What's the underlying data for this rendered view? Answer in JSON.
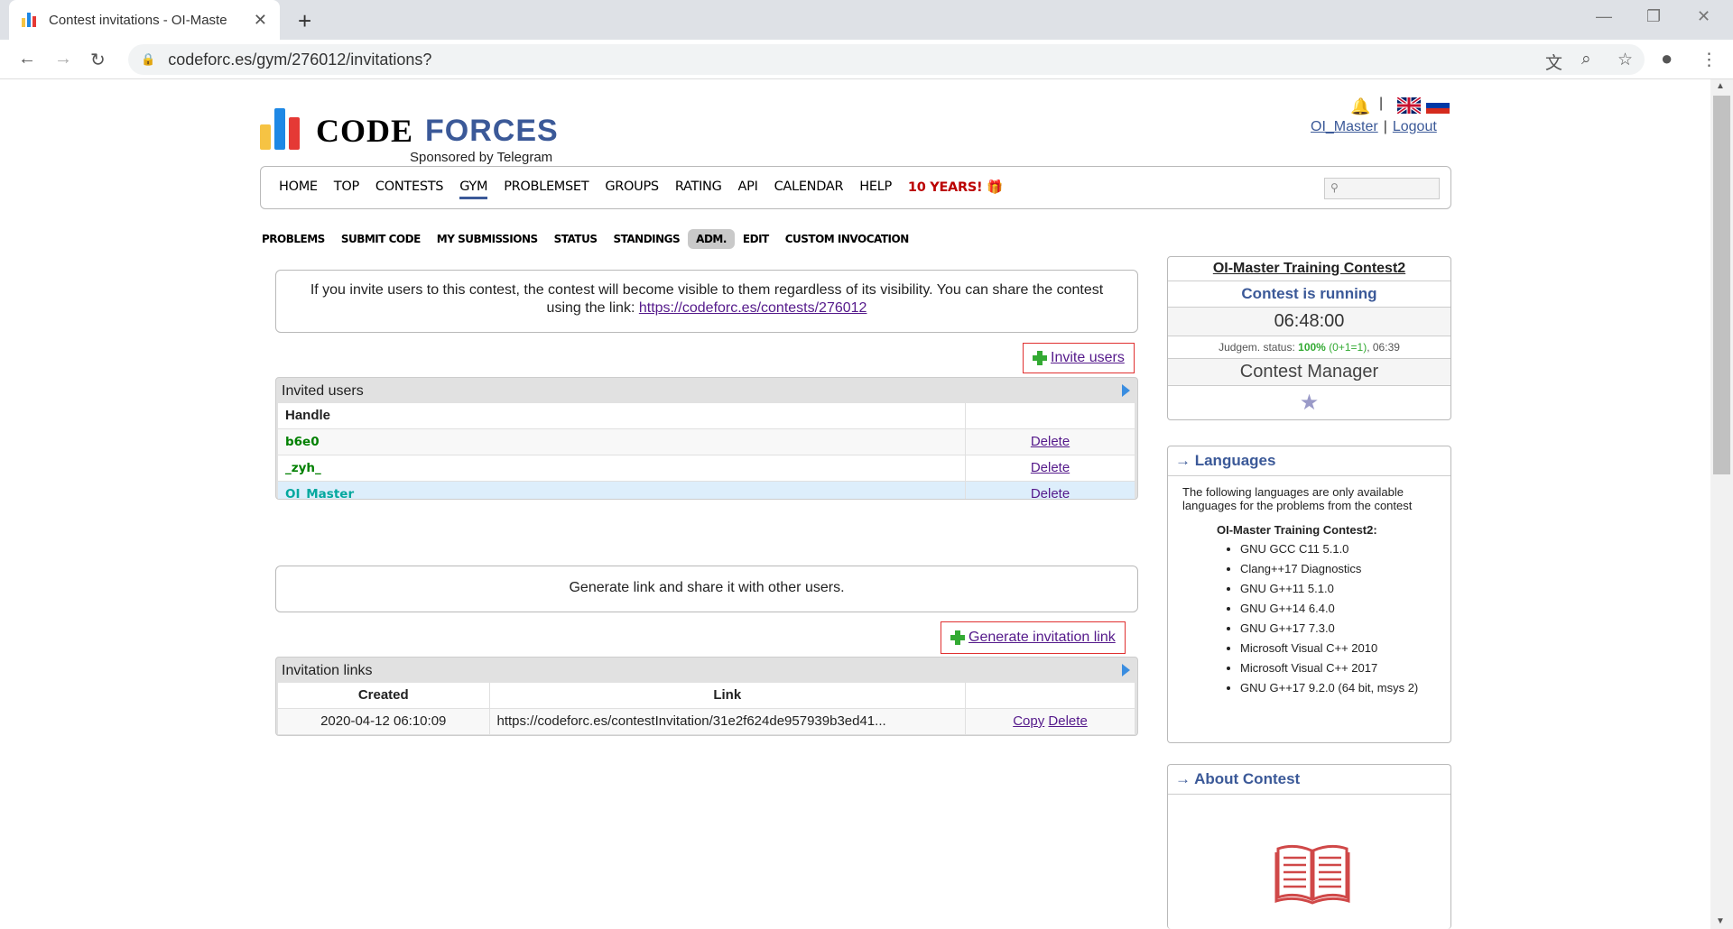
{
  "browser": {
    "tab_title": "Contest invitations - OI-Maste",
    "url": "codeforc.es/gym/276012/invitations?"
  },
  "header": {
    "logo_word1": "CODE",
    "logo_word2": "FORCES",
    "sponsor": "Sponsored by Telegram",
    "user": "OI_Master",
    "logout": "Logout",
    "separator": "|"
  },
  "menu": {
    "items": [
      "HOME",
      "TOP",
      "CONTESTS",
      "GYM",
      "PROBLEMSET",
      "GROUPS",
      "RATING",
      "API",
      "CALENDAR",
      "HELP"
    ],
    "ten_years": "10 YEARS!",
    "active": "GYM"
  },
  "submenu": {
    "items": [
      "PROBLEMS",
      "SUBMIT CODE",
      "MY SUBMISSIONS",
      "STATUS",
      "STANDINGS",
      "ADM.",
      "EDIT",
      "CUSTOM INVOCATION"
    ],
    "selected": "ADM."
  },
  "invite_notice": {
    "text": "If you invite users to this contest, the contest will become visible to them regardless of its visibility. You can share the contest using the link:",
    "link": "https://codeforc.es/contests/276012"
  },
  "invite_button": "Invite users",
  "invited_users": {
    "caption": "Invited users",
    "header": "Handle",
    "rows": [
      {
        "handle": "b6e0",
        "action": "Delete"
      },
      {
        "handle": "_zyh_",
        "action": "Delete"
      },
      {
        "handle": "OI_Master",
        "action": "Delete"
      }
    ]
  },
  "generate_notice": "Generate link and share it with other users.",
  "generate_button": "Generate invitation link",
  "invitation_links": {
    "caption": "Invitation links",
    "headers": [
      "Created",
      "Link"
    ],
    "rows": [
      {
        "created": "2020-04-12 06:10:09",
        "link": "https://codeforc.es/contestInvitation/31e2f624de957939b3ed41...",
        "copy": "Copy",
        "delete": "Delete"
      }
    ]
  },
  "sidebar": {
    "contest_name": "OI-Master Training Contest2",
    "status": "Contest is running",
    "time": "06:48:00",
    "judge_label": "Judgem. status:",
    "judge_pct": "100%",
    "judge_detail": "(0+1=1)",
    "judge_time": ", 06:39",
    "manager": "Contest Manager",
    "languages_title": "→ Languages",
    "languages_intro": "The following languages are only available languages for the problems from the contest",
    "languages_contest": "OI-Master Training Contest2:",
    "languages": [
      "GNU GCC C11 5.1.0",
      "Clang++17 Diagnostics",
      "GNU G++11 5.1.0",
      "GNU G++14 6.4.0",
      "GNU G++17 7.3.0",
      "Microsoft Visual C++ 2010",
      "Microsoft Visual C++ 2017",
      "GNU G++17 9.2.0 (64 bit, msys 2)"
    ],
    "about_title": "→ About Contest"
  },
  "colors": {
    "brand_blue": "#3b5998",
    "handle_green": "#008000",
    "handle_cyan": "#03a89e",
    "highlight_red": "#e03030"
  }
}
